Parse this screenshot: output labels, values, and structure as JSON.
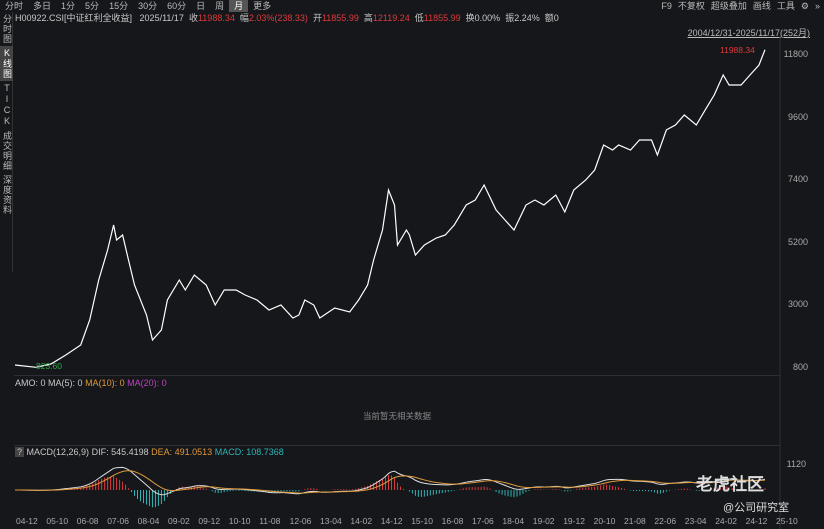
{
  "toolbar": {
    "items": [
      "分时",
      "多日",
      "1分",
      "5分",
      "15分",
      "30分",
      "60分",
      "日",
      "周",
      "月",
      "更多"
    ],
    "active": 9
  },
  "toolbar_right": [
    "F9",
    "不复权",
    "超级叠加",
    "画线",
    "工具",
    "⚙",
    "»"
  ],
  "sidebar": [
    "分时图",
    "K线图",
    "TICK",
    "成交明细",
    "深度资料"
  ],
  "info": {
    "code": "H00922.CSI[中证红利全收益]",
    "date": "2025/11/17",
    "close_label": "收",
    "close": "11988.34",
    "chg_label": "幅",
    "chg": "2.03%(238.33)",
    "open_label": "开",
    "open": "11855.99",
    "high_label": "高",
    "high": "12119.24",
    "low_label": "低",
    "low": "11855.99",
    "turnover": "换0.00%",
    "amp": "振2.24%",
    "amount": "额0"
  },
  "range": "2004/12/31-2025/11/17(252月)",
  "max_label": "11988.34",
  "min_label": "823.60",
  "amo": {
    "amo": "AMO: 0",
    "ma5": "MA(5): 0",
    "ma10": "MA(10): 0",
    "ma20": "MA(20): 0",
    "empty": "当前暂无相关数据"
  },
  "macd": {
    "help": "?",
    "name": "MACD(12,26,9)",
    "dif": "DIF: 545.4198",
    "dea": "DEA: 491.0513",
    "macd": "MACD: 108.7368",
    "axis": "1120"
  },
  "watermark": "@公司研究室",
  "brand": "老虎社区",
  "colors": {
    "up": "#e03a3a",
    "down": "#2fb5b5",
    "dea": "#e09a3a",
    "line": "#ffffff"
  },
  "chart_data": {
    "type": "line",
    "title": "H00922.CSI 月K",
    "ylabel": "",
    "ylim": [
      800,
      11800
    ],
    "yticks": [
      800,
      3000,
      5200,
      7400,
      9600,
      11800
    ],
    "xticks": [
      "04-12",
      "05-10",
      "06-08",
      "07-06",
      "08-04",
      "09-02",
      "09-12",
      "10-10",
      "11-08",
      "12-06",
      "13-04",
      "14-02",
      "14-12",
      "15-10",
      "16-08",
      "17-06",
      "18-04",
      "19-02",
      "19-12",
      "20-10",
      "21-08",
      "22-06",
      "23-04",
      "24-02",
      "24-12",
      "25-10"
    ],
    "months": [
      0,
      7,
      12,
      17,
      22,
      25,
      28,
      31,
      33,
      34,
      36,
      38,
      40,
      44,
      46,
      49,
      51,
      55,
      57,
      60,
      64,
      67,
      70,
      74,
      77,
      81,
      85,
      89,
      93,
      95,
      97,
      100,
      102,
      107,
      112,
      115,
      118,
      120,
      123,
      125,
      127,
      128,
      131,
      132,
      134,
      137,
      141,
      144,
      147,
      151,
      154,
      157,
      161,
      164,
      167,
      171,
      174,
      177,
      181,
      184,
      187,
      191,
      194,
      197,
      200,
      202,
      206,
      209,
      213,
      215,
      218,
      221,
      224,
      228,
      231,
      234,
      237,
      239,
      243,
      246,
      249,
      251
    ],
    "values": [
      905,
      824,
      940,
      1257,
      1608,
      2487,
      3893,
      4948,
      5826,
      5299,
      5475,
      4596,
      3717,
      2663,
      1784,
      2136,
      3190,
      3893,
      3542,
      4069,
      3717,
      3014,
      3542,
      3542,
      3366,
      3190,
      2839,
      3014,
      2557,
      2663,
      3190,
      3014,
      2557,
      2909,
      2768,
      3190,
      3717,
      4596,
      5651,
      7057,
      6529,
      5123,
      5651,
      5475,
      4772,
      5123,
      5369,
      5475,
      5826,
      6529,
      6705,
      7232,
      6354,
      6002,
      5651,
      6529,
      6705,
      6529,
      6881,
      6283,
      7057,
      7408,
      7760,
      8638,
      8462,
      8638,
      8462,
      8814,
      8814,
      8287,
      9166,
      9341,
      9693,
      9341,
      9869,
      10396,
      11099,
      10747,
      10747,
      11099,
      11450,
      11988
    ]
  }
}
